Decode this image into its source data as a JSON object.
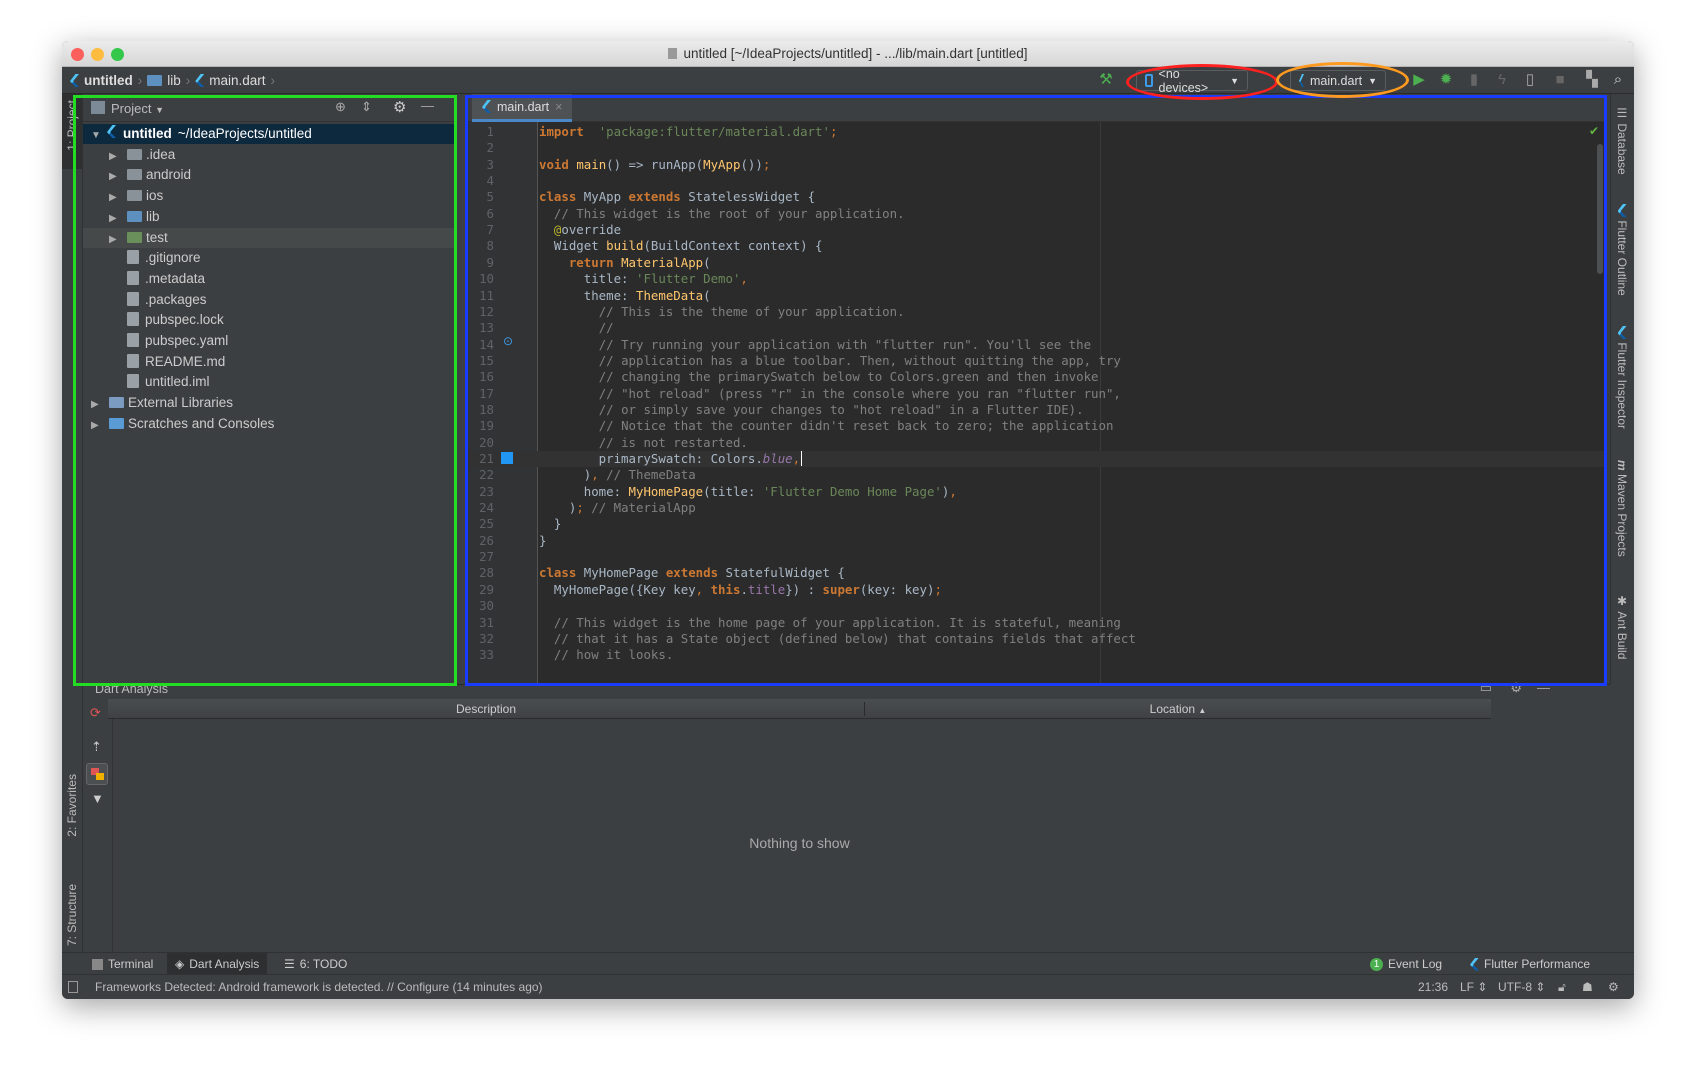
{
  "window": {
    "title": "untitled [~/IdeaProjects/untitled] - .../lib/main.dart [untitled]"
  },
  "breadcrumb": [
    "untitled",
    "lib",
    "main.dart"
  ],
  "toolbar": {
    "device_selector": "<no devices>",
    "run_config": "main.dart"
  },
  "left_strip": {
    "project": "1: Project",
    "favorites": "2: Favorites",
    "structure": "7: Structure"
  },
  "right_strip": [
    "Database",
    "Flutter Outline",
    "Flutter Inspector",
    "Maven Projects",
    "Ant Build"
  ],
  "project_panel": {
    "view_label": "Project",
    "tree": [
      {
        "label": "untitled",
        "suffix": "~/IdeaProjects/untitled",
        "depth": 0,
        "expanded": true,
        "type": "project",
        "selected": true
      },
      {
        "label": ".idea",
        "depth": 1,
        "expanded": false,
        "type": "folder"
      },
      {
        "label": "android",
        "depth": 1,
        "expanded": false,
        "type": "folder"
      },
      {
        "label": "ios",
        "depth": 1,
        "expanded": false,
        "type": "folder"
      },
      {
        "label": "lib",
        "depth": 1,
        "expanded": false,
        "type": "folder-blue"
      },
      {
        "label": "test",
        "depth": 1,
        "expanded": false,
        "type": "folder-green",
        "highlighted": true
      },
      {
        "label": ".gitignore",
        "depth": 1,
        "type": "file"
      },
      {
        "label": ".metadata",
        "depth": 1,
        "type": "file"
      },
      {
        "label": ".packages",
        "depth": 1,
        "type": "file"
      },
      {
        "label": "pubspec.lock",
        "depth": 1,
        "type": "file"
      },
      {
        "label": "pubspec.yaml",
        "depth": 1,
        "type": "file"
      },
      {
        "label": "README.md",
        "depth": 1,
        "type": "file"
      },
      {
        "label": "untitled.iml",
        "depth": 1,
        "type": "file"
      },
      {
        "label": "External Libraries",
        "depth": 0,
        "expanded": false,
        "type": "library"
      },
      {
        "label": "Scratches and Consoles",
        "depth": 0,
        "expanded": false,
        "type": "scratch"
      }
    ]
  },
  "editor": {
    "tab": "main.dart",
    "cursor_line": 21,
    "lines": [
      [
        [
          "kw",
          "import"
        ],
        [
          "",
          "  "
        ],
        [
          "str",
          "'package:flutter/material.dart'"
        ],
        [
          "pu",
          ";"
        ]
      ],
      [],
      [
        [
          "kw",
          "void"
        ],
        [
          "",
          " "
        ],
        [
          "fn",
          "main"
        ],
        [
          "",
          "() => runApp("
        ],
        [
          "fn",
          "MyApp"
        ],
        [
          "",
          "())"
        ],
        [
          "pu",
          ";"
        ]
      ],
      [],
      [
        [
          "kw",
          "class"
        ],
        [
          "",
          " MyApp "
        ],
        [
          "kw",
          "extends"
        ],
        [
          "",
          " StatelessWidget {"
        ]
      ],
      [
        [
          "",
          "  "
        ],
        [
          "cm",
          "// This widget is the root of your application."
        ]
      ],
      [
        [
          "",
          "  "
        ],
        [
          "an",
          "@"
        ],
        [
          "",
          "override"
        ]
      ],
      [
        [
          "",
          "  Widget "
        ],
        [
          "fn",
          "build"
        ],
        [
          "",
          "(BuildContext context) {"
        ]
      ],
      [
        [
          "",
          "    "
        ],
        [
          "kw",
          "return"
        ],
        [
          "",
          " "
        ],
        [
          "fn",
          "MaterialApp"
        ],
        [
          "",
          "("
        ]
      ],
      [
        [
          "",
          "      title: "
        ],
        [
          "str",
          "'Flutter Demo'"
        ],
        [
          "pu",
          ","
        ]
      ],
      [
        [
          "",
          "      theme: "
        ],
        [
          "fn",
          "ThemeData"
        ],
        [
          "",
          "("
        ]
      ],
      [
        [
          "",
          "        "
        ],
        [
          "cm",
          "// This is the theme of your application."
        ]
      ],
      [
        [
          "",
          "        "
        ],
        [
          "cm",
          "//"
        ]
      ],
      [
        [
          "",
          "        "
        ],
        [
          "cm",
          "// Try running your application with \"flutter run\". You'll see the"
        ]
      ],
      [
        [
          "",
          "        "
        ],
        [
          "cm",
          "// application has a blue toolbar. Then, without quitting the app, try"
        ]
      ],
      [
        [
          "",
          "        "
        ],
        [
          "cm",
          "// changing the primarySwatch below to Colors.green and then invoke"
        ]
      ],
      [
        [
          "",
          "        "
        ],
        [
          "cm",
          "// \"hot reload\" (press \"r\" in the console where you ran \"flutter run\","
        ]
      ],
      [
        [
          "",
          "        "
        ],
        [
          "cm",
          "// or simply save your changes to \"hot reload\" in a Flutter IDE)."
        ]
      ],
      [
        [
          "",
          "        "
        ],
        [
          "cm",
          "// Notice that the counter didn't reset back to zero; the application"
        ]
      ],
      [
        [
          "",
          "        "
        ],
        [
          "cm",
          "// is not restarted."
        ]
      ],
      [
        [
          "",
          "        primarySwatch: Colors."
        ],
        [
          "it",
          "blue"
        ],
        [
          "pu",
          ","
        ]
      ],
      [
        [
          "",
          "      )"
        ],
        [
          "pu",
          ","
        ],
        [
          "",
          " "
        ],
        [
          "cm",
          "// ThemeData"
        ]
      ],
      [
        [
          "",
          "      home: "
        ],
        [
          "fn",
          "MyHomePage"
        ],
        [
          "",
          "(title: "
        ],
        [
          "str",
          "'Flutter Demo Home Page'"
        ],
        [
          "",
          ")"
        ],
        [
          "pu",
          ","
        ]
      ],
      [
        [
          "",
          "    )"
        ],
        [
          "pu",
          ";"
        ],
        [
          "",
          " "
        ],
        [
          "cm",
          "// MaterialApp"
        ]
      ],
      [
        [
          "",
          "  }"
        ]
      ],
      [
        [
          "",
          "}"
        ]
      ],
      [],
      [
        [
          "kw",
          "class"
        ],
        [
          "",
          " MyHomePage "
        ],
        [
          "kw",
          "extends"
        ],
        [
          "",
          " StatefulWidget {"
        ]
      ],
      [
        [
          "",
          "  MyHomePage({Key key"
        ],
        [
          "pu",
          ","
        ],
        [
          "",
          " "
        ],
        [
          "kw",
          "this"
        ],
        [
          "",
          "."
        ],
        [
          "fld",
          "title"
        ],
        [
          "",
          "}) : "
        ],
        [
          "kw",
          "super"
        ],
        [
          "",
          "(key: key)"
        ],
        [
          "pu",
          ";"
        ]
      ],
      [],
      [
        [
          "",
          "  "
        ],
        [
          "cm",
          "// This widget is the home page of your application. It is stateful, meaning"
        ]
      ],
      [
        [
          "",
          "  "
        ],
        [
          "cm",
          "// that it has a State object (defined below) that contains fields that affect"
        ]
      ],
      [
        [
          "",
          "  "
        ],
        [
          "cm",
          "// how it looks."
        ]
      ]
    ]
  },
  "analysis": {
    "title": "Dart Analysis",
    "columns": [
      "Description",
      "Location"
    ],
    "empty_text": "Nothing to show"
  },
  "bottom_tabs": {
    "terminal": "Terminal",
    "dart_analysis": "Dart Analysis",
    "todo": "6: TODO",
    "event_log": "Event Log",
    "event_count": "1",
    "flutter_performance": "Flutter Performance"
  },
  "status": {
    "message": "Frameworks Detected: Android framework is detected. // Configure (14 minutes ago)",
    "position": "21:36",
    "line_sep": "LF",
    "encoding": "UTF-8"
  },
  "annotations": {
    "project_box": "#22dd22",
    "editor_box": "#1a3cff",
    "devices_ellipse": "#ff2020",
    "config_ellipse": "#ff9a20"
  }
}
